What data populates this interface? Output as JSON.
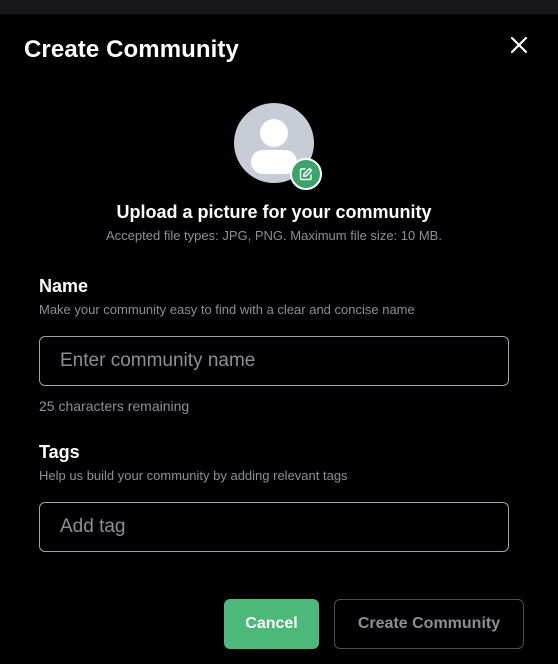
{
  "dialog": {
    "title": "Create Community",
    "close_icon": "close-icon"
  },
  "upload": {
    "avatar_icon": "user-placeholder-icon",
    "edit_icon": "edit-icon",
    "title": "Upload a picture for your community",
    "hint": "Accepted file types: JPG, PNG. Maximum file size: 10 MB.",
    "badge_color": "#3ba36b"
  },
  "name_field": {
    "label": "Name",
    "help": "Make your community easy to find with a clear and concise name",
    "value": "",
    "placeholder": "Enter community name",
    "counter": "25 characters remaining"
  },
  "tags_field": {
    "label": "Tags",
    "help": "Help us build your community by adding relevant tags",
    "value": "",
    "placeholder": "Add tag"
  },
  "actions": {
    "cancel_label": "Cancel",
    "create_label": "Create Community",
    "accent_color": "#4cb87a"
  }
}
